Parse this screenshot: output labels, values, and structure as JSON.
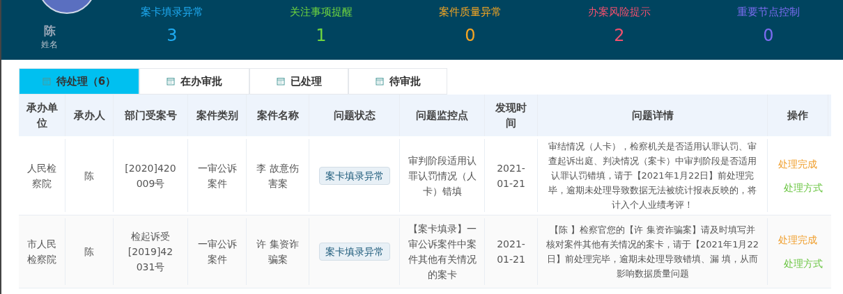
{
  "user": {
    "name": "陈",
    "label": "姓名"
  },
  "stats": [
    {
      "label": "案卡填录异常",
      "value": "3",
      "color": "#1eaaf1"
    },
    {
      "label": "关注事项提醒",
      "value": "1",
      "color": "#6fd63f"
    },
    {
      "label": "案件质量异常",
      "value": "0",
      "color": "#f5a623"
    },
    {
      "label": "办案风险提示",
      "value": "2",
      "color": "#f0506e"
    },
    {
      "label": "重要节点控制",
      "value": "0",
      "color": "#7b6cf0"
    }
  ],
  "tabs": [
    {
      "label": "待处理（6）",
      "selected": true
    },
    {
      "label": "在办审批",
      "selected": false
    },
    {
      "label": "已处理",
      "selected": false
    },
    {
      "label": "待审批",
      "selected": false
    }
  ],
  "table": {
    "columns": [
      "承办单位",
      "承办人",
      "部门受案号",
      "案件类别",
      "案件名称",
      "问题状态",
      "问题监控点",
      "发现时间",
      "问题详情",
      "操作"
    ],
    "rows": [
      {
        "unit": "人民检察院",
        "person": "陈",
        "case_no": "[2020]420 009号",
        "category": "一审公诉案件",
        "case_name": "李 故意伤害案",
        "status": "案卡填录异常",
        "monitor": "审判阶段适用认罪认罚情况（人卡）错填",
        "time": "2021-01-21",
        "detail": "审结情况（人卡），检察机关是否适用认罪认罚、审查起诉出庭、判决情况（案卡）中审判阶段是否适用认罪认罚错填，请于【2021年1月22日】前处理完毕，逾期未处理导致数据无法被统计报表反映的，将计入个人业绩考评！",
        "actions": [
          "处理完成",
          "处理方式"
        ]
      },
      {
        "unit": "市人民检察院",
        "person": "陈",
        "case_no": "检起诉受[2019]42 031号",
        "category": "一审公诉案件",
        "case_name": "许 集资诈骗案",
        "status": "案卡填录异常",
        "monitor": "【案卡填录】一审公诉案件中案件其他有关情况的案卡",
        "time": "2021-01-21",
        "detail": "【陈 】检察官您的【许 集资诈骗案】请及时填写并核对案件其他有关情况的案卡，请于【2021年1月22日】前处理完毕，逾期未处理导致错填、漏 填，从而影响数据质量问题",
        "actions": [
          "处理完成",
          "处理方式"
        ]
      }
    ]
  }
}
